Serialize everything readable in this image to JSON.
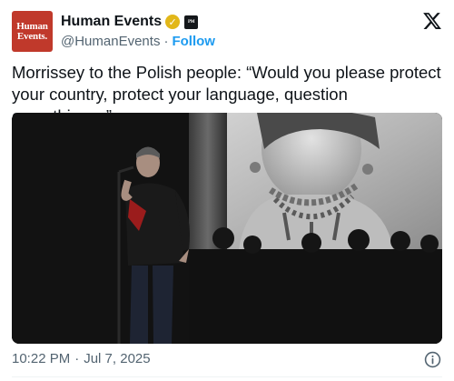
{
  "account": {
    "display_name": "Human Events",
    "handle": "@HumanEvents",
    "follow_label": "Follow",
    "separator": "·",
    "avatar_text_line1": "Human",
    "avatar_text_line2": "Events.",
    "affiliate_badge_text": "PM",
    "verified_color": "#e2b719"
  },
  "tweet": {
    "text": "Morrissey to the Polish people: “Would you please protect your country, protect your language, question everything…”",
    "time": "10:22 PM",
    "separator": "·",
    "date": "Jul 7, 2025"
  },
  "media": {
    "description_icon": "video-still"
  },
  "icons": {
    "brand": "x-logo-icon",
    "info": "info-icon",
    "verified": "verified-badge-icon"
  },
  "colors": {
    "link": "#1d9bf0",
    "muted": "#536471",
    "avatar_bg": "#c0392b"
  }
}
